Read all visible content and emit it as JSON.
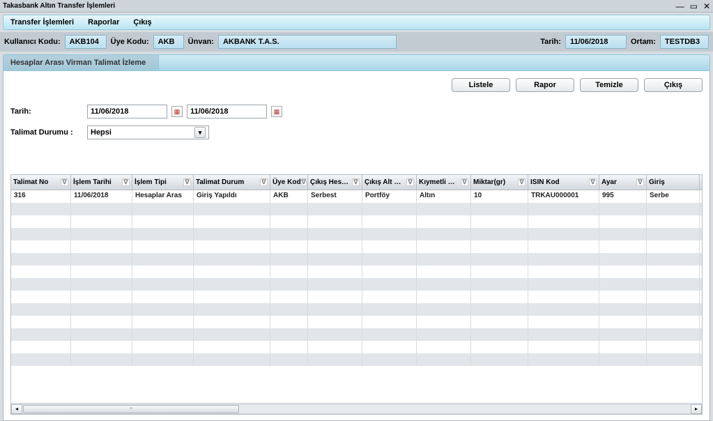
{
  "window": {
    "title": "Takasbank Altın Transfer İşlemleri"
  },
  "menu": {
    "transfer": "Transfer İşlemleri",
    "raporlar": "Raporlar",
    "cikis": "Çıkış"
  },
  "info": {
    "kullanici_label": "Kullanıcı Kodu:",
    "kullanici": "AKB104",
    "uye_label": "Üye Kodu:",
    "uye": "AKB",
    "unvan_label": "Ünvan:",
    "unvan": "AKBANK T.A.S.",
    "tarih_label": "Tarih:",
    "tarih": "11/06/2018",
    "ortam_label": "Ortam:",
    "ortam": "TESTDB3"
  },
  "tab": {
    "title": "Hesaplar Arası Virman Talimat İzleme"
  },
  "buttons": {
    "listele": "Listele",
    "rapor": "Rapor",
    "temizle": "Temizle",
    "cikis": "Çıkış"
  },
  "filters": {
    "tarih_label": "Tarih:",
    "tarih_from": "11/06/2018",
    "tarih_to": "11/06/2018",
    "durum_label": "Talimat Durumu :",
    "durum_value": "Hepsi"
  },
  "grid": {
    "headers": [
      "Talimat No",
      "İşlem Tarihi",
      "İşlem Tipi",
      "Talimat Durum",
      "Üye Kod",
      "Çıkış Hes…",
      "Çıkış Alt …",
      "Kıymetli …",
      "Miktar(gr)",
      "ISIN Kod",
      "Ayar",
      "Giriş"
    ],
    "row": {
      "talimat_no": "316",
      "islem_tarihi": "11/06/2018",
      "islem_tipi": "Hesaplar Aras",
      "talimat_durum": "Giriş Yapıldı",
      "uye_kod": "AKB",
      "cikis_hes": "Serbest",
      "cikis_alt": "Portföy",
      "kiymetli": "Altın",
      "miktar": "10",
      "isin": "TRKAU000001",
      "ayar": "995",
      "giris": "Serbe"
    }
  }
}
